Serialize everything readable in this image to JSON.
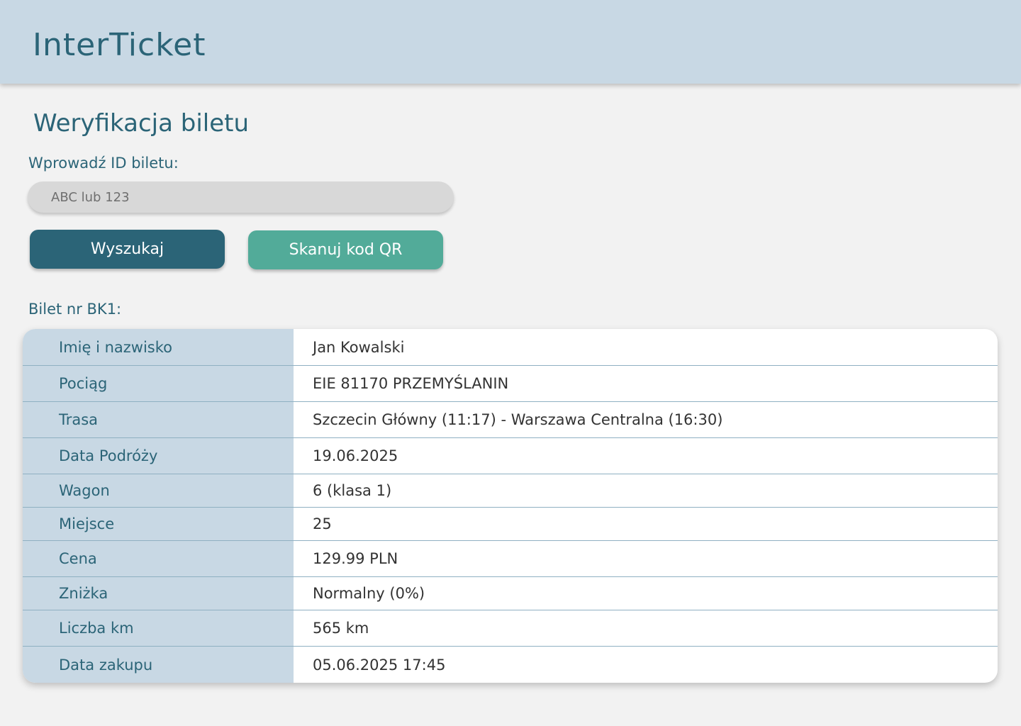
{
  "header": {
    "brand": "InterTicket"
  },
  "page": {
    "title": "Weryfikacja biletu"
  },
  "search": {
    "label": "Wprowadź ID biletu:",
    "placeholder": "ABC lub 123",
    "value": ""
  },
  "buttons": {
    "search_label": "Wyszukaj",
    "scan_label": "Skanuj kod QR"
  },
  "result": {
    "label": "Bilet nr BK1:",
    "rows": [
      {
        "key": "Imię i nazwisko",
        "value": "Jan Kowalski"
      },
      {
        "key": "Pociąg",
        "value": "EIE 81170 PRZEMYŚLANIN"
      },
      {
        "key": "Trasa",
        "value": "Szczecin Główny (11:17) - Warszawa Centralna (16:30)"
      },
      {
        "key": "Data Podróży",
        "value": "19.06.2025"
      },
      {
        "key": "Wagon",
        "value": "6 (klasa 1)"
      },
      {
        "key": "Miejsce",
        "value": "25"
      },
      {
        "key": "Cena",
        "value": "129.99 PLN"
      },
      {
        "key": "Zniżka",
        "value": "Normalny (0%)"
      },
      {
        "key": "Liczba km",
        "value": "565 km"
      },
      {
        "key": "Data zakupu",
        "value": "05.06.2025 17:45"
      }
    ]
  },
  "colors": {
    "primary": "#2b6477",
    "accent": "#52ab99",
    "header_bg": "#c8d8e4",
    "page_bg": "#f2f2f2"
  }
}
